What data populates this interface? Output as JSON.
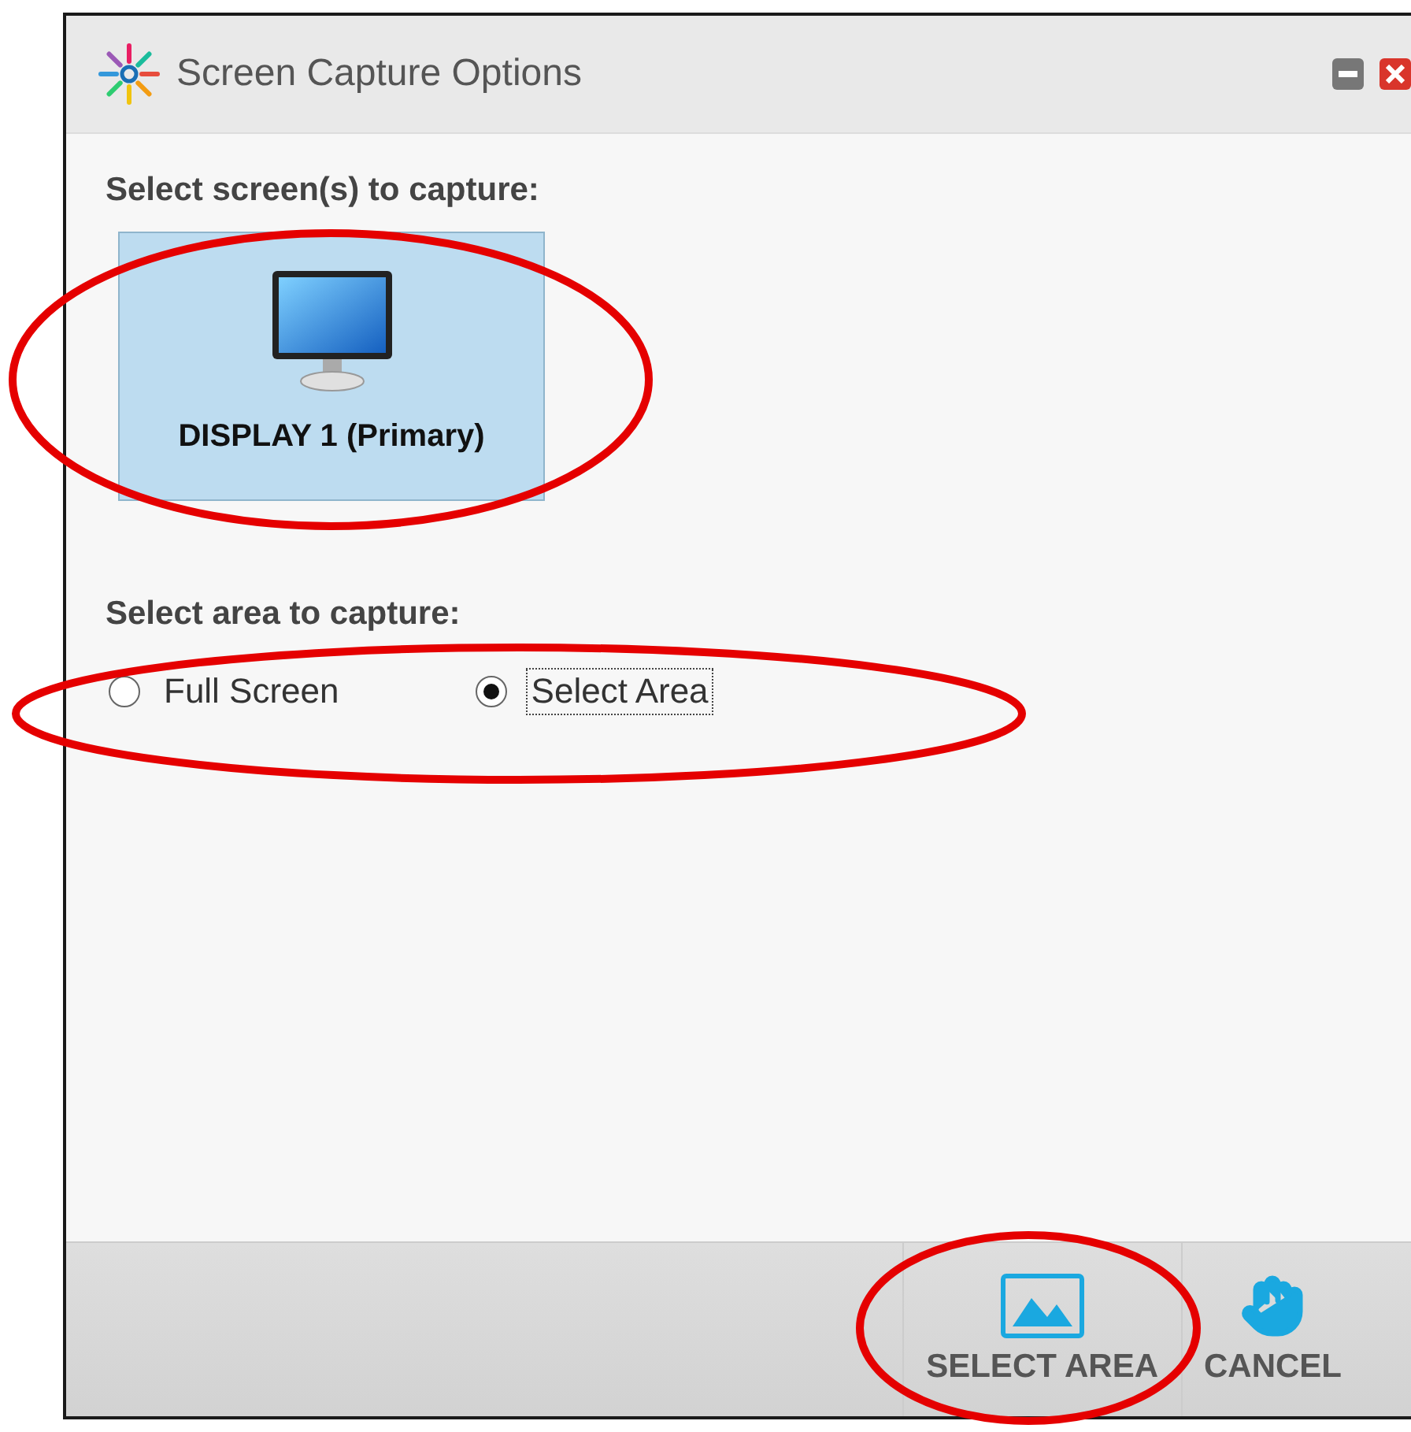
{
  "window": {
    "title": "Screen Capture Options"
  },
  "screens": {
    "heading": "Select screen(s) to capture:",
    "items": [
      {
        "label": "DISPLAY 1 (Primary)",
        "selected": true,
        "circled": true
      }
    ]
  },
  "area": {
    "heading": "Select area to capture:",
    "circled": true,
    "options": [
      {
        "label": "Full Screen",
        "selected": false,
        "focused": false
      },
      {
        "label": "Select Area",
        "selected": true,
        "focused": true
      }
    ]
  },
  "footer": {
    "buttons": [
      {
        "kind": "select",
        "label": "SELECT AREA",
        "circled": true
      },
      {
        "kind": "cancel",
        "label": "CANCEL",
        "circled": false
      }
    ]
  }
}
